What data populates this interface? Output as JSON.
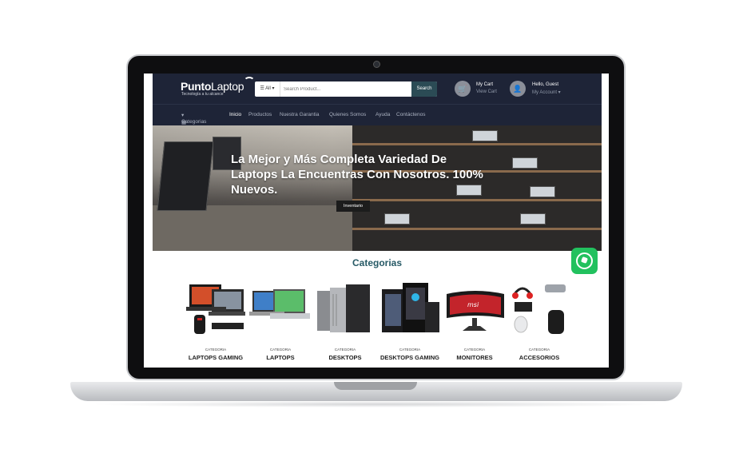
{
  "header": {
    "logo_main": "Punto",
    "logo_light": "Laptop",
    "tagline": "Tecnología a tu alcance",
    "search": {
      "category": "All",
      "placeholder": "Search Product...",
      "button": "Search"
    },
    "cart": {
      "title": "My Cart",
      "link": "View Cart"
    },
    "account": {
      "greeting": "Hello, Guest",
      "link": "My Account"
    }
  },
  "nav": {
    "categories": "Categorias",
    "items": [
      "Inicio",
      "Productos",
      "Nuestra Garantia",
      "Quienes Somos",
      "Ayuda",
      "Contáctenos"
    ]
  },
  "hero": {
    "title": "La Mejor y Más Completa Variedad De Laptops La Encuentras Con Nosotros. 100% Nuevos.",
    "button": "Inventario"
  },
  "categories": {
    "title": "Categorias",
    "items": [
      {
        "label": "CATEGORIA",
        "name": "LAPTOPS GAMING"
      },
      {
        "label": "CATEGORIA",
        "name": "LAPTOPS"
      },
      {
        "label": "CATEGORIA",
        "name": "DESKTOPS"
      },
      {
        "label": "CATEGORIA",
        "name": "DESKTOPS GAMING"
      },
      {
        "label": "CATEGORIA",
        "name": "MONITORES"
      },
      {
        "label": "CATEGORIA",
        "name": "ACCESORIOS"
      }
    ]
  },
  "icons": {
    "cart": "cart-icon",
    "account": "user-icon",
    "whatsapp": "whatsapp-icon",
    "grid": "grid-icon"
  },
  "colors": {
    "header_bg": "#1e2437",
    "search_button": "#2b4b55",
    "category_title": "#275a66",
    "whatsapp": "#22c15e"
  }
}
